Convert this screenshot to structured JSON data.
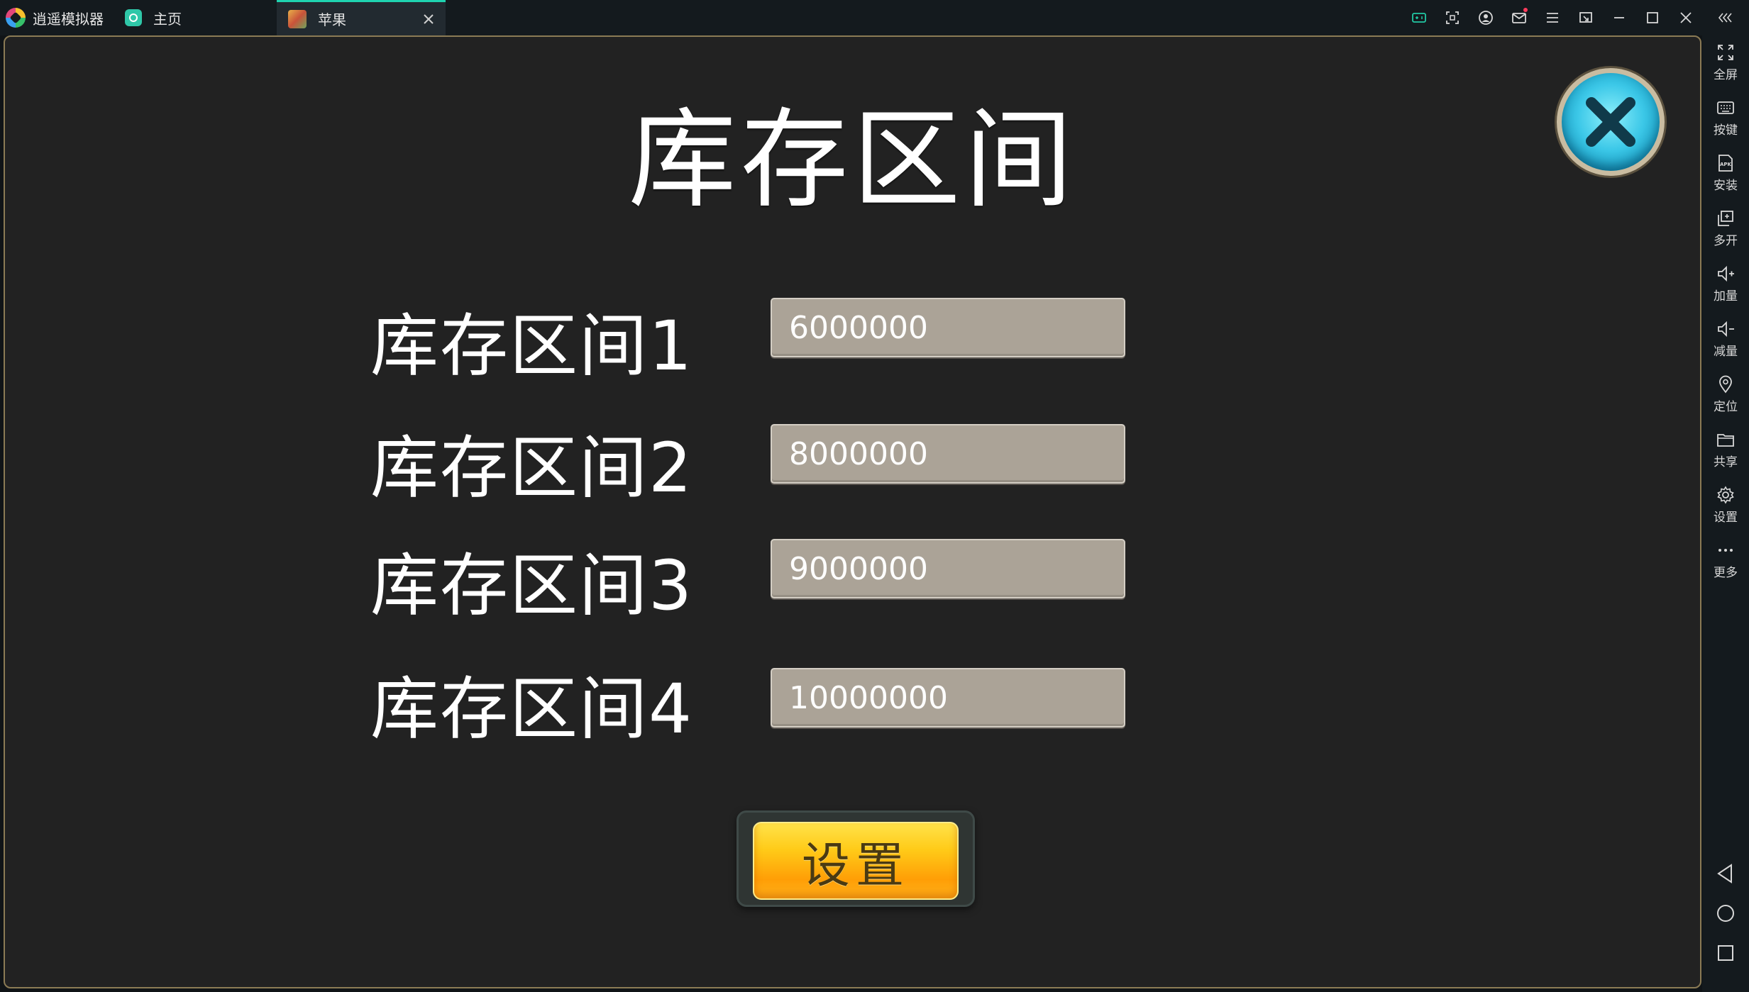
{
  "app": {
    "name": "逍遥模拟器"
  },
  "tabs": [
    {
      "label": "主页",
      "active": false
    },
    {
      "label": "苹果",
      "active": true
    }
  ],
  "window_controls": [
    "keymap-icon",
    "screenshot-icon",
    "account-icon",
    "mail-icon",
    "menu-icon",
    "restore-small-icon",
    "minimize-icon",
    "maximize-icon",
    "close-icon",
    "collapse-icon"
  ],
  "sidebar": {
    "items": [
      {
        "label": "全屏",
        "icon": "fullscreen-icon"
      },
      {
        "label": "按键",
        "icon": "keyboard-icon"
      },
      {
        "label": "安装",
        "icon": "apk-install-icon"
      },
      {
        "label": "多开",
        "icon": "multi-instance-icon"
      },
      {
        "label": "加量",
        "icon": "volume-up-icon"
      },
      {
        "label": "减量",
        "icon": "volume-down-icon"
      },
      {
        "label": "定位",
        "icon": "location-icon"
      },
      {
        "label": "共享",
        "icon": "folder-icon"
      },
      {
        "label": "设置",
        "icon": "gear-icon"
      },
      {
        "label": "更多",
        "icon": "more-icon"
      }
    ],
    "nav": [
      "back-icon",
      "home-icon",
      "recents-icon"
    ]
  },
  "game": {
    "title": "库存区间",
    "rows": [
      {
        "label": "库存区间1",
        "value": "6000000"
      },
      {
        "label": "库存区间2",
        "value": "8000000"
      },
      {
        "label": "库存区间3",
        "value": "9000000"
      },
      {
        "label": "库存区间4",
        "value": "10000000"
      }
    ],
    "set_button": "设置"
  },
  "colors": {
    "accent": "#1fd3b0",
    "field_bg": "#aba397",
    "button_gold": "#ffcb18",
    "close_cyan": "#3cc8e8"
  }
}
